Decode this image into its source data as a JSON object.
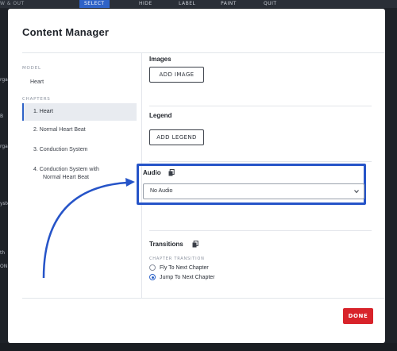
{
  "background": {
    "toolbar_left": "W & OUT",
    "toolbar_tools": [
      "SELECT",
      "HIDE",
      "LABEL",
      "PAINT",
      "QUIT"
    ],
    "side_fragments": [
      "rgan",
      "B",
      "rgan",
      "ystem",
      "th",
      "ON"
    ]
  },
  "modal": {
    "title": "Content Manager",
    "model_label": "MODEL",
    "model_name": "Heart",
    "chapters_label": "CHAPTERS",
    "chapters": [
      {
        "text": "1.  Heart"
      },
      {
        "text": "2.  Normal Heart Beat"
      },
      {
        "text": "3.  Conduction System"
      },
      {
        "text": "4.  Conduction System with",
        "text2": "Normal Heart Beat"
      }
    ],
    "images": {
      "title": "Images",
      "button": "ADD IMAGE"
    },
    "legend": {
      "title": "Legend",
      "button": "ADD LEGEND"
    },
    "audio": {
      "title": "Audio",
      "selected": "No Audio"
    },
    "transitions": {
      "title": "Transitions",
      "group_label": "CHAPTER TRANSITION",
      "options": [
        "Fly To Next Chapter",
        "Jump To Next Chapter"
      ],
      "selected_index": 1
    },
    "done_label": "DONE"
  },
  "colors": {
    "accent": "#2f63c7",
    "highlight": "#2654c8",
    "done": "#d8232a"
  }
}
